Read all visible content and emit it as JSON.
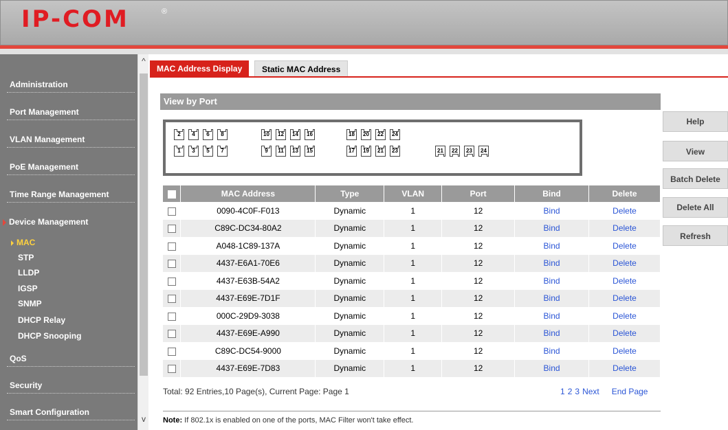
{
  "brand": {
    "logo": "IP-COM",
    "reg_mark": "®"
  },
  "sidebar": {
    "items": [
      {
        "label": "Administration"
      },
      {
        "label": "Port Management"
      },
      {
        "label": "VLAN Management"
      },
      {
        "label": "PoE Management"
      },
      {
        "label": "Time Range Management"
      },
      {
        "label": "Device Management"
      },
      {
        "label": "QoS"
      },
      {
        "label": "Security"
      },
      {
        "label": "Smart Configuration"
      }
    ],
    "sub_items": [
      {
        "label": "MAC"
      },
      {
        "label": "STP"
      },
      {
        "label": "LLDP"
      },
      {
        "label": "IGSP"
      },
      {
        "label": "SNMP"
      },
      {
        "label": "DHCP Relay"
      },
      {
        "label": "DHCP Snooping"
      }
    ],
    "scroll_up": "^",
    "scroll_down": "v"
  },
  "tabs": [
    {
      "label": "MAC Address Display"
    },
    {
      "label": "Static MAC Address"
    }
  ],
  "section_title": "View by Port",
  "ports": {
    "top": [
      "2",
      "4",
      "6",
      "8",
      "10",
      "12",
      "14",
      "16",
      "18",
      "20",
      "22",
      "24"
    ],
    "bottom": [
      "1",
      "3",
      "5",
      "7",
      "9",
      "11",
      "13",
      "15",
      "17",
      "19",
      "21",
      "23"
    ],
    "sfp": [
      "21",
      "22",
      "23",
      "24"
    ]
  },
  "table": {
    "headers": [
      "MAC Address",
      "Type",
      "VLAN",
      "Port",
      "Bind",
      "Delete"
    ],
    "rows": [
      {
        "mac": "0090-4C0F-F013",
        "type": "Dynamic",
        "vlan": "1",
        "port": "12",
        "bind": "Bind",
        "del": "Delete"
      },
      {
        "mac": "C89C-DC34-80A2",
        "type": "Dynamic",
        "vlan": "1",
        "port": "12",
        "bind": "Bind",
        "del": "Delete"
      },
      {
        "mac": "A048-1C89-137A",
        "type": "Dynamic",
        "vlan": "1",
        "port": "12",
        "bind": "Bind",
        "del": "Delete"
      },
      {
        "mac": "4437-E6A1-70E6",
        "type": "Dynamic",
        "vlan": "1",
        "port": "12",
        "bind": "Bind",
        "del": "Delete"
      },
      {
        "mac": "4437-E63B-54A2",
        "type": "Dynamic",
        "vlan": "1",
        "port": "12",
        "bind": "Bind",
        "del": "Delete"
      },
      {
        "mac": "4437-E69E-7D1F",
        "type": "Dynamic",
        "vlan": "1",
        "port": "12",
        "bind": "Bind",
        "del": "Delete"
      },
      {
        "mac": "000C-29D9-3038",
        "type": "Dynamic",
        "vlan": "1",
        "port": "12",
        "bind": "Bind",
        "del": "Delete"
      },
      {
        "mac": "4437-E69E-A990",
        "type": "Dynamic",
        "vlan": "1",
        "port": "12",
        "bind": "Bind",
        "del": "Delete"
      },
      {
        "mac": "C89C-DC54-9000",
        "type": "Dynamic",
        "vlan": "1",
        "port": "12",
        "bind": "Bind",
        "del": "Delete"
      },
      {
        "mac": "4437-E69E-7D83",
        "type": "Dynamic",
        "vlan": "1",
        "port": "12",
        "bind": "Bind",
        "del": "Delete"
      }
    ]
  },
  "pagination": {
    "summary": "Total: 92 Entries,10 Page(s), Current Page: Page 1",
    "pages": [
      "1",
      "2",
      "3"
    ],
    "next": "Next",
    "end": "End Page"
  },
  "note": {
    "label": "Note:",
    "text": " If 802.1x is enabled on one of the ports, MAC Filter won't take effect."
  },
  "buttons": {
    "help": "Help",
    "view": "View",
    "batch_delete": "Batch Delete",
    "delete_all": "Delete All",
    "refresh": "Refresh"
  },
  "colors": {
    "brand_red": "#e01c23",
    "tab_red": "#d7221b",
    "link_blue": "#2a55d6",
    "sidebar_gray": "#7a7a7a"
  }
}
